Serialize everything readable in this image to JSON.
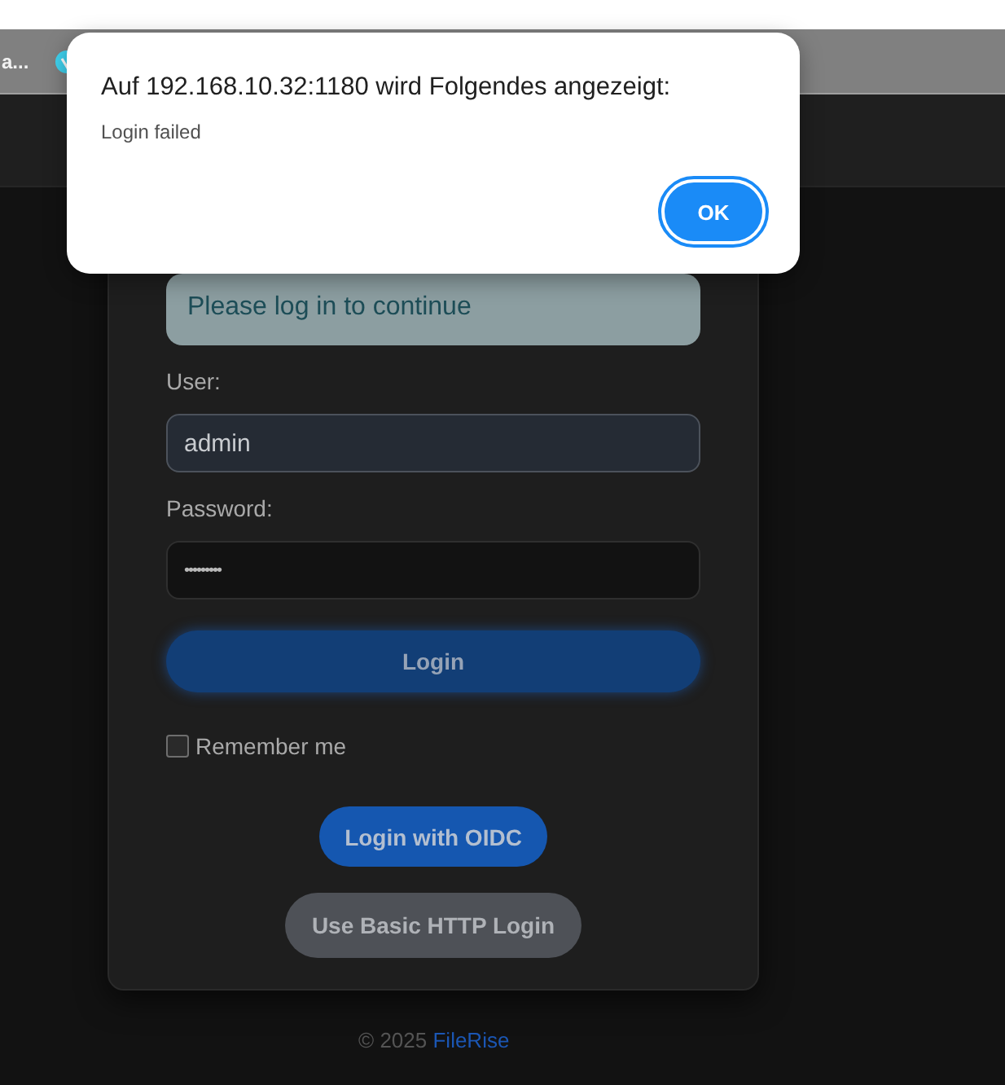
{
  "browser": {
    "bookmark_label": "a..."
  },
  "dialog": {
    "title": "Auf 192.168.10.32:1180 wird Folgendes angezeigt:",
    "message": "Login failed",
    "button": "OK"
  },
  "login_form": {
    "notice": "Please log in to continue",
    "fields": [
      {
        "label": "User:",
        "value": "admin",
        "kind": "text"
      },
      {
        "label": "Password:",
        "value": "•••••••••",
        "kind": "password"
      }
    ],
    "submit": "Login",
    "remember": {
      "label": "Remember me",
      "checked": false
    },
    "buttons": [
      {
        "label": "Login with OIDC",
        "kind": "primary"
      },
      {
        "label": "Use Basic HTTP Login",
        "kind": "secondary"
      }
    ]
  },
  "footer": {
    "copyright": "© 2025",
    "link": "FileRise"
  }
}
